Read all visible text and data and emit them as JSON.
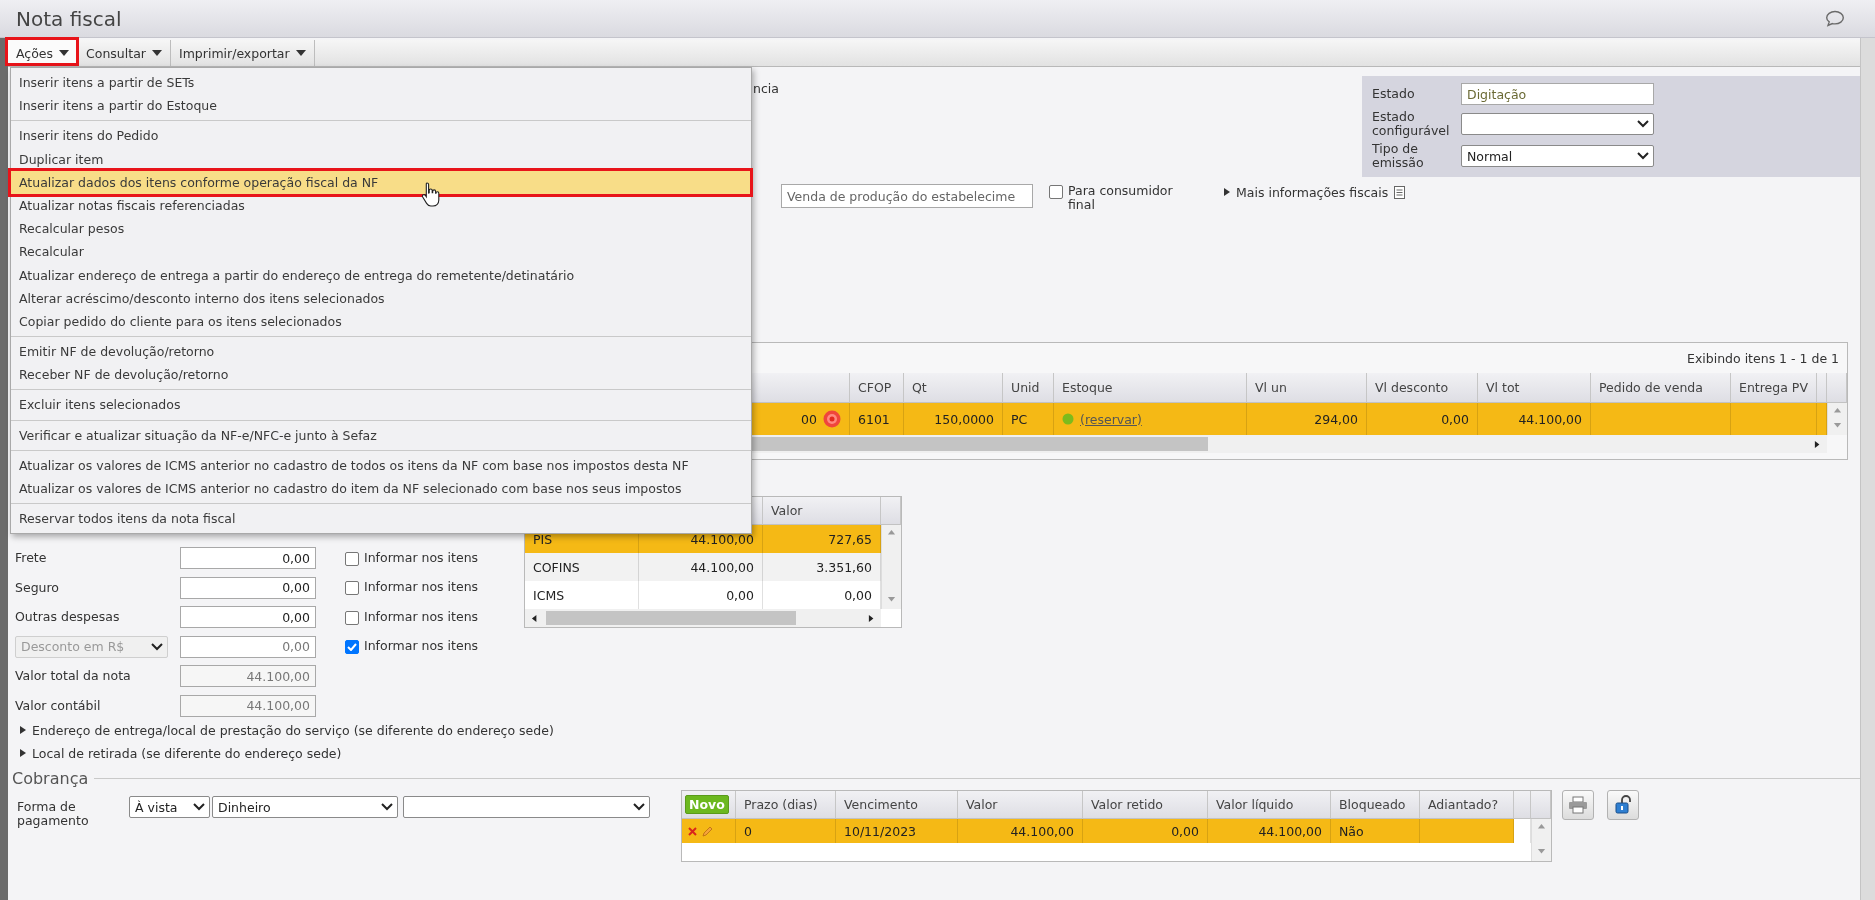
{
  "window": {
    "title": "Nota fiscal"
  },
  "toolbar": [
    {
      "label": "Ações",
      "open": true,
      "marked": true
    },
    {
      "label": "Consultar",
      "open": false,
      "marked": false
    },
    {
      "label": "Imprimir/exportar",
      "open": false,
      "marked": false
    }
  ],
  "actions_menu": {
    "groups": [
      [
        {
          "label": "Inserir itens a partir de SETs",
          "selected": false,
          "marked": false
        },
        {
          "label": "Inserir itens a partir do Estoque",
          "selected": false,
          "marked": false
        }
      ],
      [
        {
          "label": "Inserir itens do Pedido",
          "selected": false,
          "marked": false
        },
        {
          "label": "Duplicar item",
          "selected": false,
          "marked": false
        },
        {
          "label": "Atualizar dados dos itens conforme operação fiscal da NF",
          "selected": true,
          "marked": true
        },
        {
          "label": "Atualizar notas fiscais referenciadas",
          "selected": false,
          "marked": false
        },
        {
          "label": "Recalcular pesos",
          "selected": false,
          "marked": false
        },
        {
          "label": "Recalcular",
          "selected": false,
          "marked": false
        },
        {
          "label": "Atualizar endereço de entrega a partir do endereço de entrega do remetente/detinatário",
          "selected": false,
          "marked": false
        },
        {
          "label": "Alterar acréscimo/desconto interno dos itens selecionados",
          "selected": false,
          "marked": false
        },
        {
          "label": "Copiar pedido do cliente para os itens selecionados",
          "selected": false,
          "marked": false
        }
      ],
      [
        {
          "label": "Emitir NF de devolução/retorno",
          "selected": false,
          "marked": false
        },
        {
          "label": "Receber NF de devolução/retorno",
          "selected": false,
          "marked": false
        }
      ],
      [
        {
          "label": "Excluir itens selecionados",
          "selected": false,
          "marked": false
        }
      ],
      [
        {
          "label": "Verificar e atualizar situação da NF-e/NFC-e junto à Sefaz",
          "selected": false,
          "marked": false
        }
      ],
      [
        {
          "label": "Atualizar os valores de ICMS anterior no cadastro de todos os itens da NF com base nos impostos desta NF",
          "selected": false,
          "marked": false
        },
        {
          "label": "Atualizar os valores de ICMS anterior no cadastro do item da NF selecionado com base nos seus impostos",
          "selected": false,
          "marked": false
        }
      ],
      [
        {
          "label": "Reservar todos itens da nota fiscal",
          "selected": false,
          "marked": false
        }
      ]
    ]
  },
  "header": {
    "cut_label": "ncia",
    "status": [
      {
        "label": "Estado",
        "kind": "text",
        "value": "Digitação"
      },
      {
        "label": "Estado configurável",
        "kind": "select"
      },
      {
        "label": "Tipo de emissão",
        "kind": "select",
        "value": "Normal"
      }
    ],
    "operation": {
      "value": "Venda de produção do estabelecime"
    },
    "final_consumer": {
      "label": "Para consumidor final",
      "checked": false
    },
    "more_info": {
      "label": "Mais informações fiscais",
      "expanded": false
    }
  },
  "items": {
    "count_text": "Exibindo itens 1 - 1 de 1",
    "columns": [
      "",
      "CFOP",
      "Qt",
      "Unid",
      "Estoque",
      "Vl un",
      "Vl desconto",
      "Vl tot",
      "Pedido de venda",
      "Entrega PV"
    ],
    "rows": [
      {
        "selected": true,
        "alert": true,
        "stock_available": true,
        "cells": [
          "00",
          "6101",
          "150,0000",
          "PC",
          "(reservar)",
          "294,00",
          "0,00",
          "44.100,00"
        ]
      }
    ]
  },
  "totals": [
    {
      "label": "Frete",
      "kind": "input",
      "value": "0,00",
      "propagate": {
        "label": "Informar nos itens",
        "checked": false
      }
    },
    {
      "label": "Seguro",
      "kind": "input",
      "value": "0,00",
      "propagate": {
        "label": "Informar nos itens",
        "checked": false
      }
    },
    {
      "label": "Outras despesas",
      "kind": "input",
      "value": "0,00",
      "propagate": {
        "label": "Informar nos itens",
        "checked": false
      }
    },
    {
      "label": "Desconto em R$",
      "kind": "select",
      "value": "0,00",
      "propagate": {
        "label": "Informar nos itens",
        "checked": true
      }
    },
    {
      "label": "Valor total da nota",
      "kind": "readonly",
      "value": "44.100,00"
    },
    {
      "label": "Valor contábil",
      "kind": "readonly",
      "value": "44.100,00"
    }
  ],
  "taxes": {
    "columns": [
      "",
      "",
      "Valor"
    ],
    "rows": [
      {
        "name": "PIS",
        "base": "44.100,00",
        "value": "727,65",
        "selected": true
      },
      {
        "name": "COFINS",
        "base": "44.100,00",
        "value": "3.351,60",
        "selected": false
      },
      {
        "name": "ICMS",
        "base": "0,00",
        "value": "0,00",
        "selected": false
      }
    ]
  },
  "sections": [
    {
      "label": "Endereço de entrega/local de prestação do serviço (se diferente do endereço sede)",
      "expanded": false
    },
    {
      "label": "Local de retirada (se diferente do endereço sede)",
      "expanded": false
    }
  ],
  "billing": {
    "title": "Cobrança",
    "payment_label": "Forma de pagamento",
    "selects": [
      {
        "kind": "value",
        "value": "À vista"
      },
      {
        "kind": "value",
        "value": "Dinheiro"
      },
      {
        "kind": "blank"
      }
    ],
    "columns": [
      "Novo",
      "Prazo (dias)",
      "Vencimento",
      "Valor",
      "Valor retido",
      "Valor líquido",
      "Bloqueado",
      "Adiantado?"
    ],
    "rows": [
      {
        "selected": true,
        "cells": [
          "",
          "0",
          "10/11/2023",
          "44.100,00",
          "0,00",
          "44.100,00",
          "Não"
        ]
      }
    ]
  }
}
